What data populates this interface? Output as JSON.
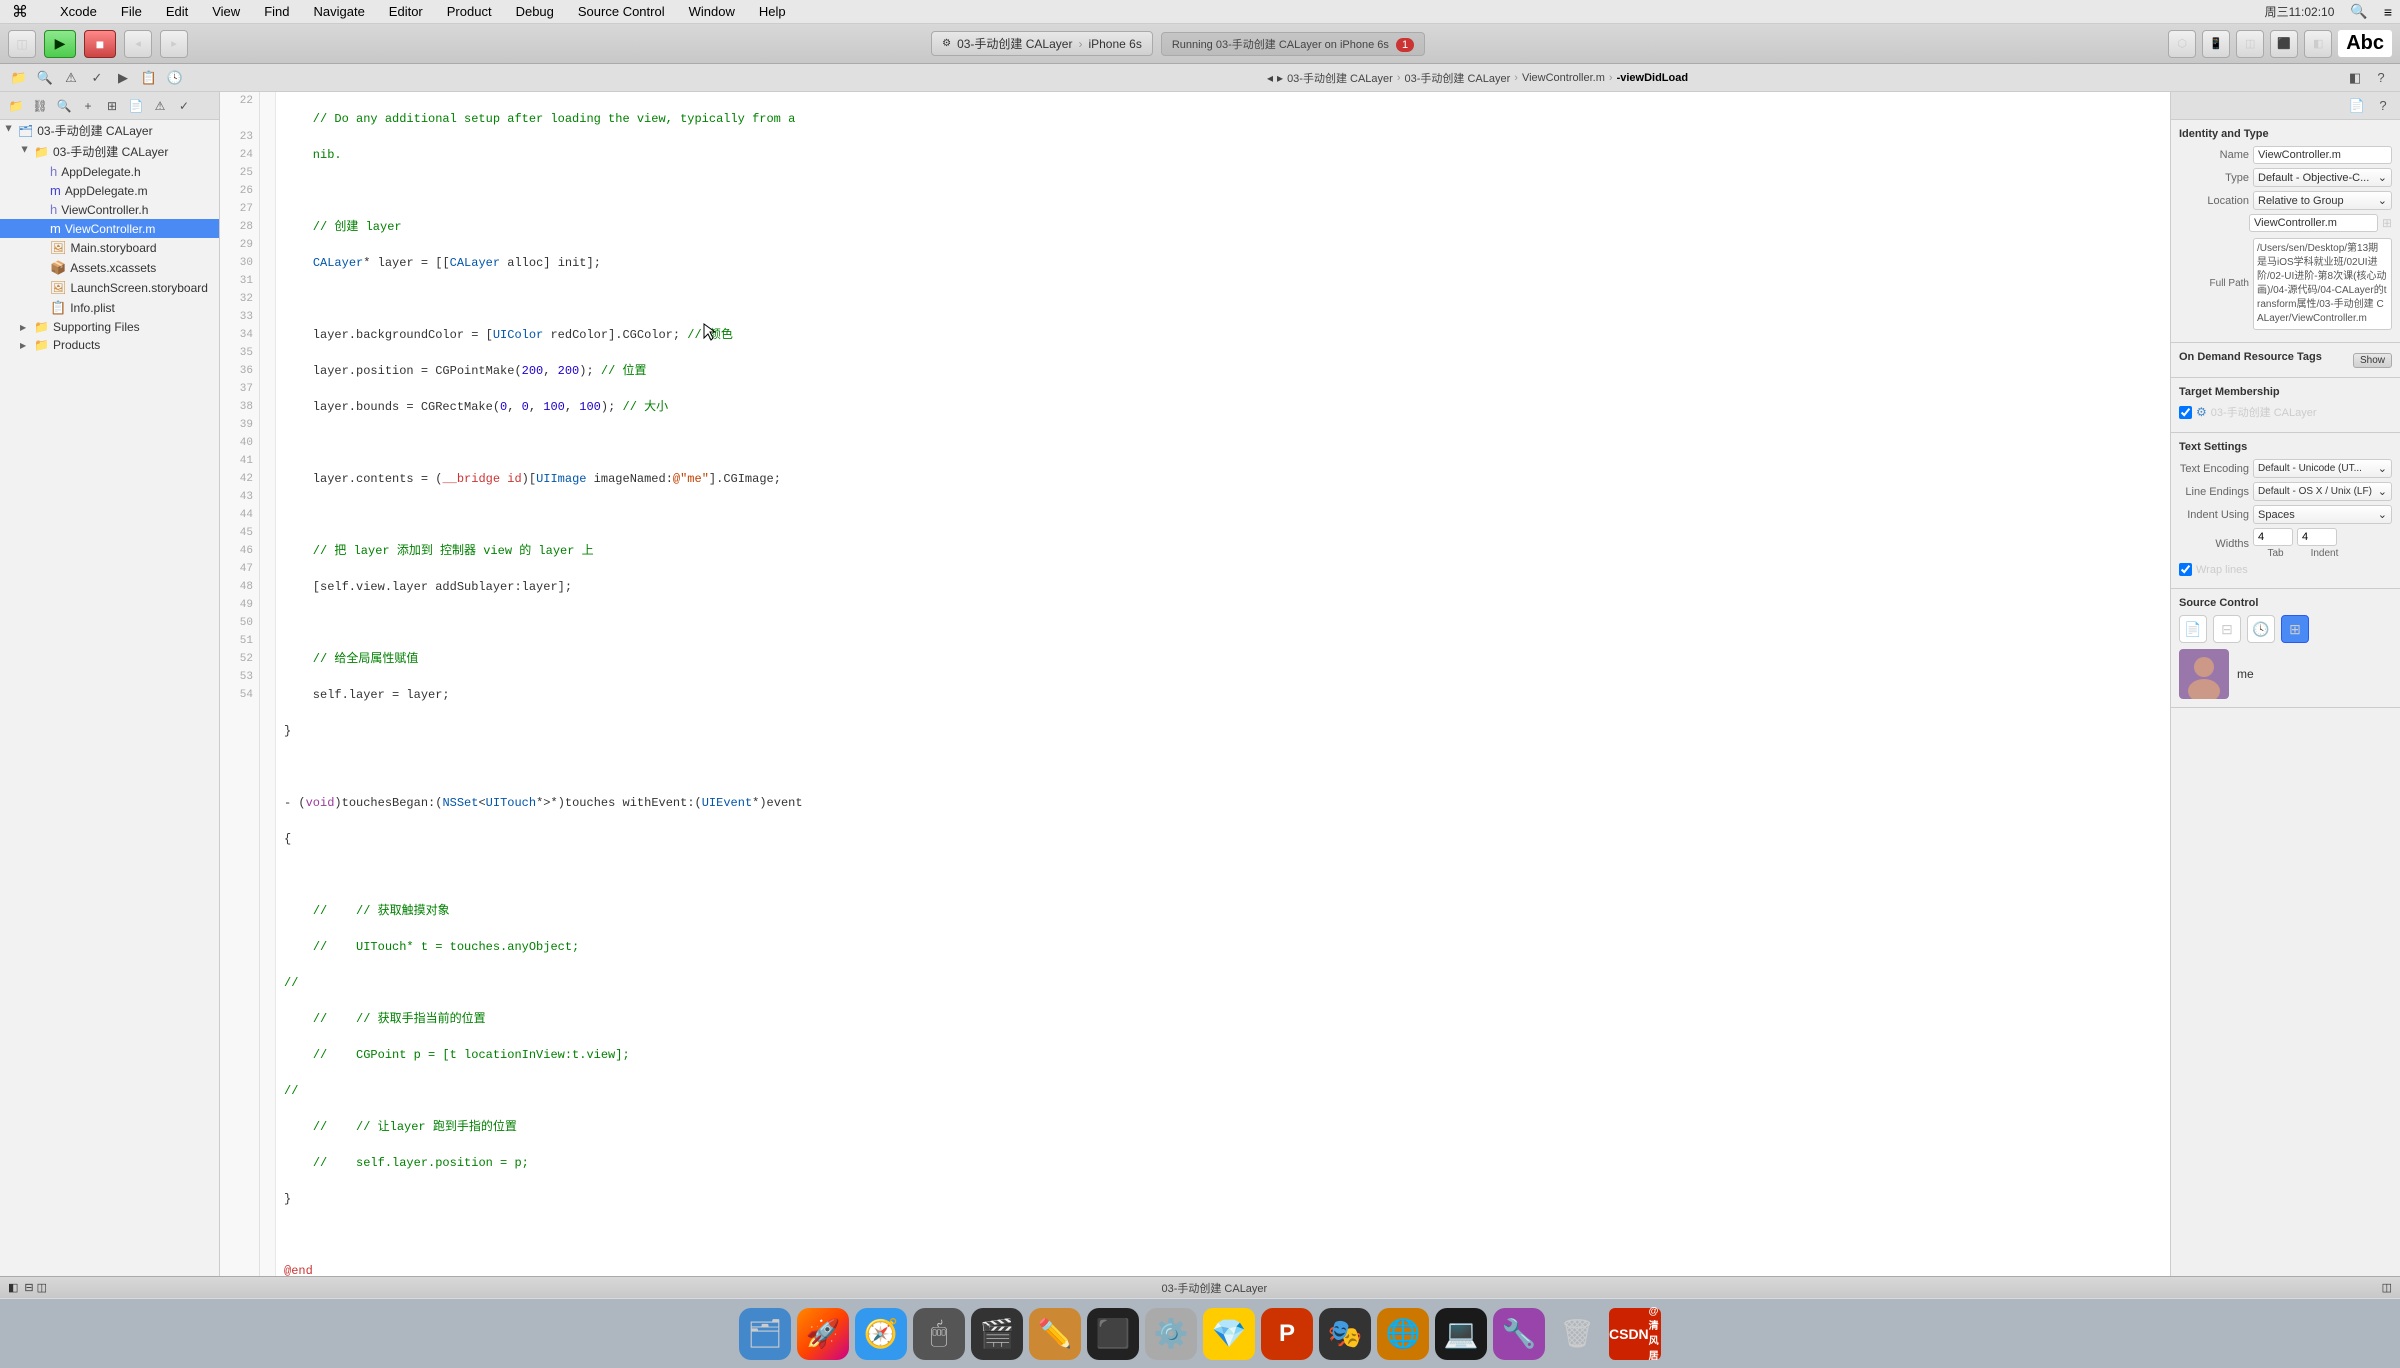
{
  "menubar": {
    "apple": "⌘",
    "items": [
      "Xcode",
      "File",
      "Edit",
      "View",
      "Find",
      "Navigate",
      "Editor",
      "Product",
      "Debug",
      "Source Control",
      "Window",
      "Help"
    ]
  },
  "toolbar": {
    "run_label": "▶",
    "stop_label": "■",
    "scheme": "03-手动创建 CALayer",
    "device": "iPhone 6s",
    "running_status": "Running 03-手动创建 CALayer on iPhone 6s",
    "error_count": "1",
    "abc_label": "Abc"
  },
  "breadcrumb": {
    "items": [
      "03-手动创建 CALayer",
      "03-手动创建 CALayer",
      "ViewController.m",
      "-viewDidLoad"
    ]
  },
  "sidebar": {
    "title": "03-手动创建 CALayer",
    "items": [
      {
        "id": "root",
        "label": "03-手动创建 CALayer",
        "level": 0,
        "arrow": "open",
        "icon": "📁"
      },
      {
        "id": "subroot",
        "label": "03-手动创建 CALayer",
        "level": 1,
        "arrow": "open",
        "icon": "📁"
      },
      {
        "id": "appdelegate_h",
        "label": "AppDelegate.h",
        "level": 2,
        "arrow": "",
        "icon": "📄"
      },
      {
        "id": "appdelegate_m",
        "label": "AppDelegate.m",
        "level": 2,
        "arrow": "",
        "icon": "📄"
      },
      {
        "id": "viewcontroller_h",
        "label": "ViewController.h",
        "level": 2,
        "arrow": "",
        "icon": "📄"
      },
      {
        "id": "viewcontroller_m",
        "label": "ViewController.m",
        "level": 2,
        "arrow": "",
        "icon": "📄",
        "selected": true
      },
      {
        "id": "main_storyboard",
        "label": "Main.storyboard",
        "level": 2,
        "arrow": "",
        "icon": "🖼"
      },
      {
        "id": "assets",
        "label": "Assets.xcassets",
        "level": 2,
        "arrow": "",
        "icon": "📦"
      },
      {
        "id": "launch_storyboard",
        "label": "LaunchScreen.storyboard",
        "level": 2,
        "arrow": "",
        "icon": "🖼"
      },
      {
        "id": "info_plist",
        "label": "Info.plist",
        "level": 2,
        "arrow": "",
        "icon": "📋"
      },
      {
        "id": "supporting_files",
        "label": "Supporting Files",
        "level": 1,
        "arrow": "closed",
        "icon": "📁"
      },
      {
        "id": "products",
        "label": "Products",
        "level": 1,
        "arrow": "closed",
        "icon": "📁"
      }
    ]
  },
  "editor": {
    "lines": [
      {
        "num": "22",
        "code": "    // Do any additional setup after loading the view, typically from a",
        "type": "comment"
      },
      {
        "num": "",
        "code": "    nib.",
        "type": "comment"
      },
      {
        "num": "23",
        "code": ""
      },
      {
        "num": "24",
        "code": "    // 创建 layer",
        "type": "comment"
      },
      {
        "num": "25",
        "code": "    CALayer* layer = [[CALayer alloc] init];"
      },
      {
        "num": "26",
        "code": ""
      },
      {
        "num": "27",
        "code": "    layer.backgroundColor = [UIColor redColor].CGColor; // 颜色"
      },
      {
        "num": "28",
        "code": "    layer.position = CGPointMake(200, 200); // 位置"
      },
      {
        "num": "29",
        "code": "    layer.bounds = CGRectMake(0, 0, 100, 100); // 大小"
      },
      {
        "num": "30",
        "code": ""
      },
      {
        "num": "31",
        "code": "    layer.contents = (__bridge id)[UIImage imageNamed:@\"me\"].CGImage;"
      },
      {
        "num": "32",
        "code": ""
      },
      {
        "num": "33",
        "code": "    // 把 layer 添加到 控制器 view 的 layer 上"
      },
      {
        "num": "34",
        "code": "    [self.view.layer addSublayer:layer];"
      },
      {
        "num": "35",
        "code": ""
      },
      {
        "num": "36",
        "code": "    // 给全局属性赋值"
      },
      {
        "num": "37",
        "code": "    self.layer = layer;"
      },
      {
        "num": "38",
        "code": "}"
      },
      {
        "num": "39",
        "code": ""
      },
      {
        "num": "40",
        "code": "- (void)touchesBegan:(NSSet<UITouch*>*)touches withEvent:(UIEvent*)event"
      },
      {
        "num": "41",
        "code": "{"
      },
      {
        "num": "42",
        "code": ""
      },
      {
        "num": "43",
        "code": "    //    // 获取触摸对象",
        "type": "comment"
      },
      {
        "num": "44",
        "code": "    //    UITouch* t = touches.anyObject;",
        "type": "comment"
      },
      {
        "num": "45",
        "code": "//"
      },
      {
        "num": "46",
        "code": "    //    // 获取手指当前的位置",
        "type": "comment"
      },
      {
        "num": "47",
        "code": "    //    CGPoint p = [t locationInView:t.view];",
        "type": "comment"
      },
      {
        "num": "48",
        "code": "//"
      },
      {
        "num": "49",
        "code": "    //    // 让layer 跑到手指的位置",
        "type": "comment"
      },
      {
        "num": "50",
        "code": "    //    self.layer.position = p;",
        "type": "comment"
      },
      {
        "num": "51",
        "code": "}"
      },
      {
        "num": "52",
        "code": ""
      },
      {
        "num": "53",
        "code": "@end"
      },
      {
        "num": "54",
        "code": ""
      }
    ]
  },
  "inspector": {
    "section_identity": "Identity and Type",
    "name_label": "Name",
    "name_value": "ViewController.m",
    "type_label": "Type",
    "type_value": "Default - Objective-C...",
    "location_label": "Location",
    "location_value": "Relative to Group",
    "full_path_label": "Full Path",
    "full_path_value": "/Users/sen/Desktop/第13期是马iOS学科就业班/02UI进阶/02-UI进阶-第8次课(核心动画)/04-源代码/04-CALayer的transform属性/03-手动创建 CALayer/ViewController.m",
    "section_resource": "On Demand Resource Tags",
    "show_label": "Show",
    "section_target": "Target Membership",
    "target_value": "03-手动创建 CALayer",
    "section_text": "Text Settings",
    "encoding_label": "Text Encoding",
    "encoding_value": "Default - Unicode (UT...",
    "endings_label": "Line Endings",
    "endings_value": "Default - OS X / Unix (LF)",
    "indent_label": "Indent Using",
    "indent_value": "Spaces",
    "widths_label": "Widths",
    "tab_label": "Tab",
    "indent_label2": "Indent",
    "tab_width": "4",
    "indent_width": "4",
    "wrap_label": "Wrap lines",
    "section_source": "Source Control",
    "user_name": "me"
  },
  "statusbar": {
    "scheme_label": "03-手动创建 CALayer"
  },
  "dock": {
    "items": [
      {
        "id": "finder",
        "emoji": "🗂",
        "bg": "#4488cc"
      },
      {
        "id": "launchpad",
        "emoji": "🚀",
        "bg": "#888"
      },
      {
        "id": "safari",
        "emoji": "🧭",
        "bg": "#3399ee"
      },
      {
        "id": "mouse",
        "emoji": "🖱",
        "bg": "#555"
      },
      {
        "id": "video",
        "emoji": "🎬",
        "bg": "#333"
      },
      {
        "id": "pencil",
        "emoji": "✏️",
        "bg": "#cc8833"
      },
      {
        "id": "terminal",
        "emoji": "⬛",
        "bg": "#222"
      },
      {
        "id": "settings",
        "emoji": "⚙️",
        "bg": "#999"
      },
      {
        "id": "sketch",
        "emoji": "💎",
        "bg": "#eee"
      },
      {
        "id": "ps",
        "emoji": "🅟",
        "bg": "#1155aa"
      },
      {
        "id": "movie",
        "emoji": "🎭",
        "bg": "#444"
      },
      {
        "id": "games",
        "emoji": "🎮",
        "bg": "#228822"
      },
      {
        "id": "browser",
        "emoji": "🌐",
        "bg": "#cc2200"
      },
      {
        "id": "tool",
        "emoji": "🔧",
        "bg": "#775500"
      },
      {
        "id": "trash",
        "emoji": "🗑",
        "bg": "#aaa"
      }
    ]
  },
  "colors": {
    "toolbar_bg": "#d0d0d0",
    "sidebar_bg": "#f2f2f2",
    "editor_bg": "#ffffff",
    "inspector_bg": "#f0f0f0",
    "selected_bg": "#4a8af4",
    "comment": "#008000",
    "keyword": "#c33",
    "string": "#c04000",
    "type": "#0055aa"
  }
}
